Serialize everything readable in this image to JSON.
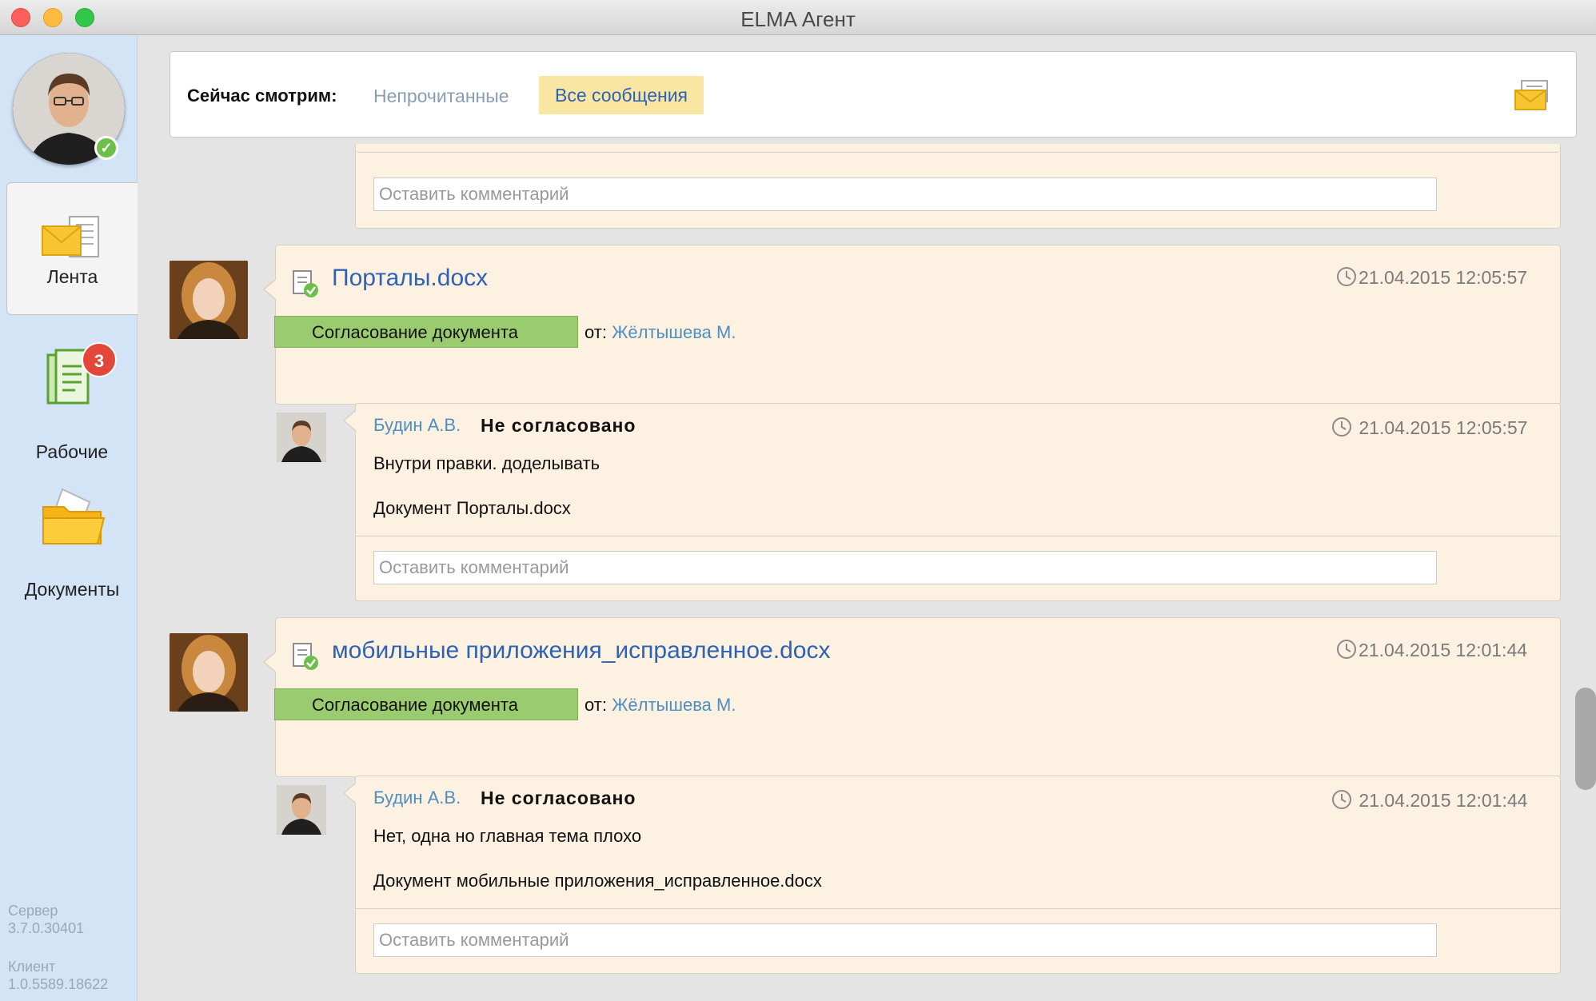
{
  "window": {
    "title": "ELMA Агент"
  },
  "sidebar": {
    "nav": [
      {
        "label": "Лента",
        "icon": "envelope-icon"
      },
      {
        "label": "Рабочие",
        "icon": "tasks-icon",
        "badge": "3"
      },
      {
        "label": "Документы",
        "icon": "folder-icon"
      }
    ],
    "server_label": "Сервер",
    "server_version": "3.7.0.30401",
    "client_label": "Клиент",
    "client_version": "1.0.5589.18622"
  },
  "filter": {
    "label": "Сейчас смотрим:",
    "unread": "Непрочитанные",
    "all": "Все сообщения"
  },
  "comment_placeholder": "Оставить комментарий",
  "feed": [
    {
      "title": "Порталы.docx",
      "timestamp": "21.04.2015 12:05:57",
      "tag": "Согласование документа",
      "from_label": "от:",
      "from_name": "Жёлтышева М.",
      "reply": {
        "author": "Будин А.В.",
        "status": "Не согласовано",
        "timestamp": "21.04.2015 12:05:57",
        "text": "Внутри правки. доделывать",
        "document": "Документ Порталы.docx"
      }
    },
    {
      "title": "мобильные приложения_исправленное.docx",
      "timestamp": "21.04.2015 12:01:44",
      "tag": "Согласование документа",
      "from_label": "от:",
      "from_name": "Жёлтышева М.",
      "reply": {
        "author": "Будин А.В.",
        "status": "Не согласовано",
        "timestamp": "21.04.2015 12:01:44",
        "text": "Нет, одна но главная тема плохо",
        "document": "Документ мобильные приложения_исправленное.docx"
      }
    }
  ],
  "colors": {
    "accent_link": "#2d62b9",
    "author_link": "#4f8ec2",
    "card_bg": "#fdf1e1",
    "tag_green": "#9bcb6f",
    "filter_active_bg": "#f8e6a2",
    "badge_red": "#e2473a",
    "sidebar_bg": "#d3e4f7"
  }
}
